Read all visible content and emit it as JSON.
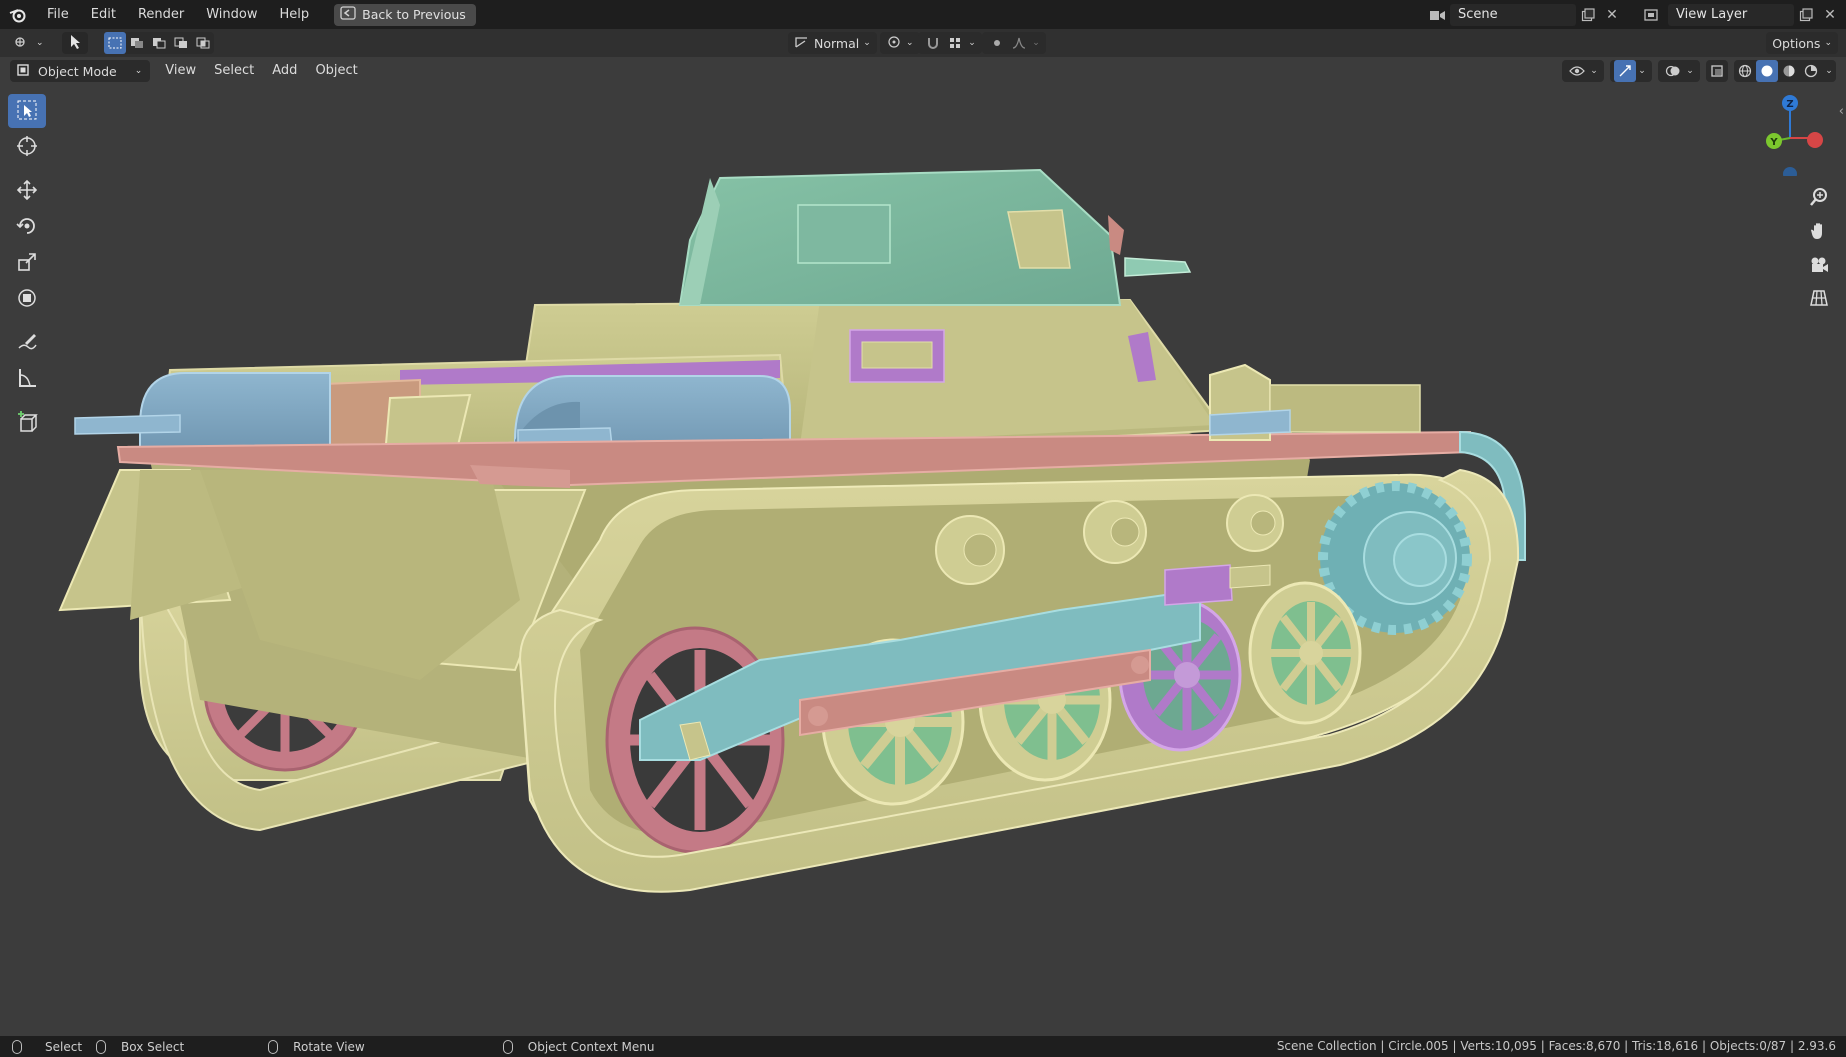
{
  "menu": {
    "items": [
      "File",
      "Edit",
      "Render",
      "Window",
      "Help"
    ],
    "back_button": "Back to Previous"
  },
  "scene": {
    "name": "Scene",
    "view_layer": "View Layer"
  },
  "tool_header": {
    "transform_orientation": "Normal",
    "options": "Options"
  },
  "view_header": {
    "mode": "Object Mode",
    "menus": [
      "View",
      "Select",
      "Add",
      "Object"
    ]
  },
  "toolbar": {
    "tools": [
      "select-box",
      "cursor",
      "move",
      "rotate",
      "scale",
      "transform",
      "annotate",
      "measure",
      "add-cube"
    ]
  },
  "gizmo": {
    "z": "Z",
    "y": "Y"
  },
  "status": {
    "select": "Select",
    "box_select": "Box Select",
    "rotate_view": "Rotate View",
    "context_menu": "Object Context Menu",
    "stats": "Scene Collection | Circle.005 | Verts:10,095 | Faces:8,670 | Tris:18,616 | Objects:0/87 | 2.93.6"
  },
  "colors": {
    "accent": "#4772b3",
    "hull": "#c9c78a",
    "turret": "#7fb9a0",
    "fender": "#c98a82",
    "blue_part": "#7fa6c2",
    "purple_part": "#b07ac9",
    "teal_part": "#7fbcbf",
    "red_wheel": "#c47a86"
  }
}
